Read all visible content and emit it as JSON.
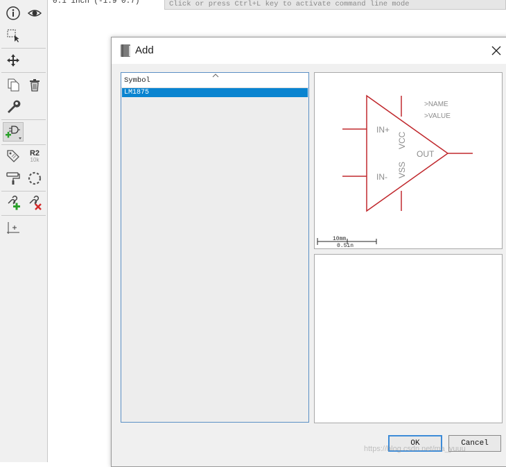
{
  "status": {
    "coordinates": "0.1 inch (-1.9 0.7)",
    "command_placeholder": "Click or press Ctrl+L key to activate command line mode"
  },
  "toolbar": {
    "tools": [
      "info-icon",
      "eye-icon",
      "select-icon",
      "move-icon",
      "copy-icon",
      "delete-icon",
      "wrench-icon",
      "add-part-icon",
      "tag-icon",
      "name-icon",
      "group-icon",
      "paint-icon",
      "net-add-icon",
      "net-delete-icon",
      "origin-icon"
    ],
    "name_tool": {
      "big": "R2",
      "small": "10k"
    }
  },
  "dialog": {
    "title": "Add",
    "list": {
      "column_header": "Symbol",
      "items": [
        {
          "label": "LM1875",
          "selected": true
        }
      ]
    },
    "preview": {
      "pins": {
        "in_plus": "IN+",
        "in_minus": "IN-",
        "out": "OUT",
        "vcc": "VCC",
        "vss": "VSS"
      },
      "name_placeholder": ">NAME",
      "value_placeholder": ">VALUE",
      "scale_mm": "10mm",
      "scale_in": "0.5in"
    },
    "buttons": {
      "ok": "OK",
      "cancel": "Cancel"
    }
  },
  "watermark": "https://blog.csdn.net/ma_yuuu",
  "colors": {
    "accent": "#0a84d0",
    "symbol_red": "#c0282d",
    "pin_text": "#8c8c8c"
  }
}
